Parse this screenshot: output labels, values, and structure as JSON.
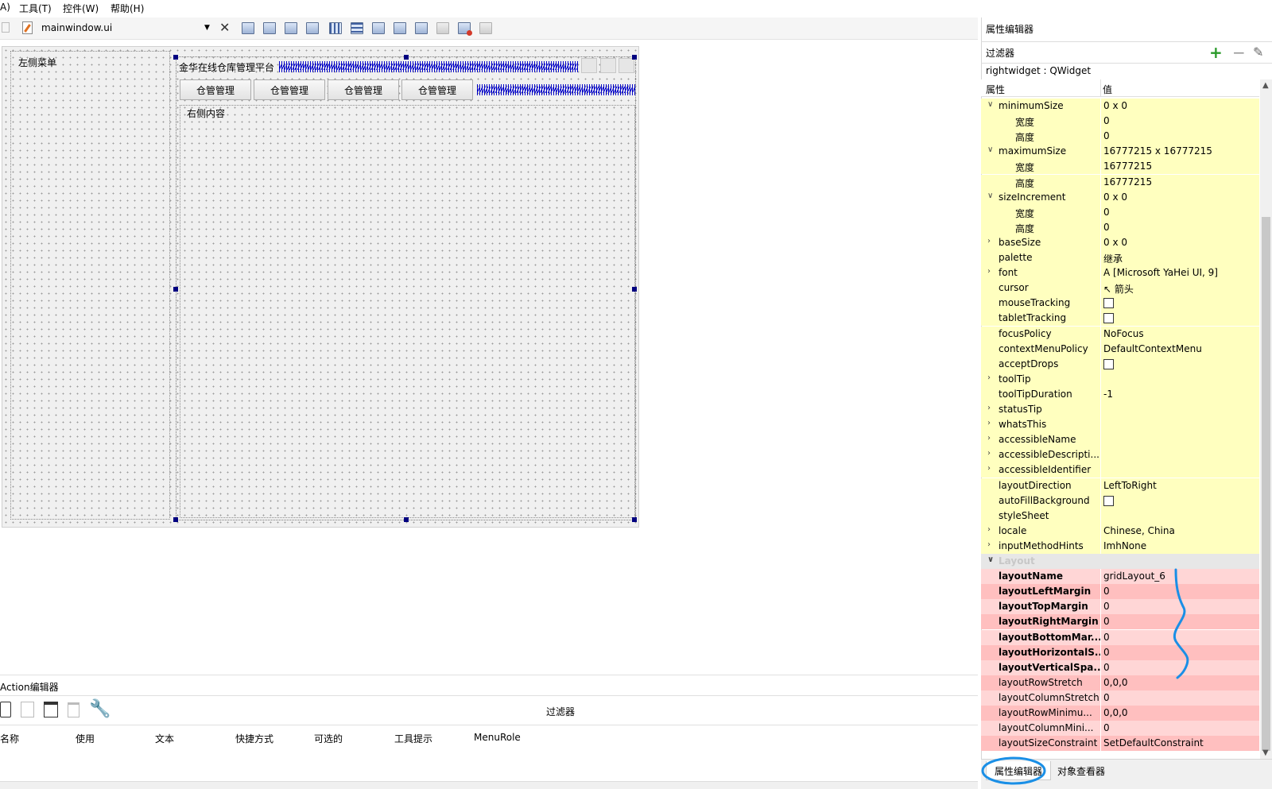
{
  "menubar": {
    "items": [
      "A)",
      "工具(T)",
      "控件(W)",
      "帮助(H)"
    ]
  },
  "toolbar": {
    "file_combo": "mainwindow.ui",
    "icons": [
      "edit-widgets-icon",
      "edit-signals-icon",
      "edit-buddies-icon",
      "edit-tab-order-icon",
      "layout-horizontal-icon",
      "layout-vertical-icon",
      "splitter-horizontal-icon",
      "splitter-vertical-icon",
      "layout-form-icon",
      "layout-grid-icon",
      "break-layout-icon",
      "adjust-size-icon"
    ]
  },
  "form": {
    "left_menu_label": "左侧菜单",
    "title_label": "金华在线仓库管理平台",
    "buttons": [
      "仓管管理",
      "仓管管理",
      "仓管管理",
      "仓管管理"
    ],
    "right_content_label": "右侧内容"
  },
  "action_editor": {
    "title": "Action编辑器",
    "filter_label": "过滤器",
    "columns": [
      "名称",
      "使用",
      "文本",
      "快捷方式",
      "可选的",
      "工具提示",
      "MenuRole"
    ]
  },
  "property_editor": {
    "title": "属性编辑器",
    "filter_label": "过滤器",
    "object_label": "rightwidget : QWidget",
    "header_property": "属性",
    "header_value": "值",
    "rows": [
      {
        "name": "minimumSize",
        "value": "0 x 0",
        "exp": "v"
      },
      {
        "name": "宽度",
        "value": "0",
        "sub": true
      },
      {
        "name": "高度",
        "value": "0",
        "sub": true
      },
      {
        "name": "maximumSize",
        "value": "16777215 x 16777215",
        "exp": "v"
      },
      {
        "name": "宽度",
        "value": "16777215",
        "sub": true
      },
      {
        "name": "高度",
        "value": "16777215",
        "sub": true
      },
      {
        "name": "sizeIncrement",
        "value": "0 x 0",
        "exp": "v"
      },
      {
        "name": "宽度",
        "value": "0",
        "sub": true
      },
      {
        "name": "高度",
        "value": "0",
        "sub": true
      },
      {
        "name": "baseSize",
        "value": "0 x 0",
        "exp": ">"
      },
      {
        "name": "palette",
        "value": "继承"
      },
      {
        "name": "font",
        "value": "A  [Microsoft YaHei UI, 9]",
        "exp": ">"
      },
      {
        "name": "cursor",
        "value": "↖  箭头"
      },
      {
        "name": "mouseTracking",
        "value": "",
        "check": true
      },
      {
        "name": "tabletTracking",
        "value": "",
        "check": true
      },
      {
        "name": "focusPolicy",
        "value": "NoFocus"
      },
      {
        "name": "contextMenuPolicy",
        "value": "DefaultContextMenu"
      },
      {
        "name": "acceptDrops",
        "value": "",
        "check": true
      },
      {
        "name": "toolTip",
        "value": "",
        "exp": ">"
      },
      {
        "name": "toolTipDuration",
        "value": "-1"
      },
      {
        "name": "statusTip",
        "value": "",
        "exp": ">"
      },
      {
        "name": "whatsThis",
        "value": "",
        "exp": ">"
      },
      {
        "name": "accessibleName",
        "value": "",
        "exp": ">"
      },
      {
        "name": "accessibleDescripti...",
        "value": "",
        "exp": ">"
      },
      {
        "name": "accessibleIdentifier",
        "value": "",
        "exp": ">"
      },
      {
        "name": "layoutDirection",
        "value": "LeftToRight"
      },
      {
        "name": "autoFillBackground",
        "value": "",
        "check": true
      },
      {
        "name": "styleSheet",
        "value": ""
      },
      {
        "name": "locale",
        "value": "Chinese, China",
        "exp": ">"
      },
      {
        "name": "inputMethodHints",
        "value": "ImhNone",
        "exp": ">"
      }
    ],
    "layout_group": "Layout",
    "layout_rows": [
      {
        "name": "layoutName",
        "value": "gridLayout_6",
        "bold": true
      },
      {
        "name": "layoutLeftMargin",
        "value": "0",
        "bold": true
      },
      {
        "name": "layoutTopMargin",
        "value": "0",
        "bold": true
      },
      {
        "name": "layoutRightMargin",
        "value": "0",
        "bold": true
      },
      {
        "name": "layoutBottomMar...",
        "value": "0",
        "bold": true
      },
      {
        "name": "layoutHorizontalS...",
        "value": "0",
        "bold": true
      },
      {
        "name": "layoutVerticalSpa...",
        "value": "0",
        "bold": true
      },
      {
        "name": "layoutRowStretch",
        "value": "0,0,0"
      },
      {
        "name": "layoutColumnStretch",
        "value": "0"
      },
      {
        "name": "layoutRowMinimu...",
        "value": "0,0,0"
      },
      {
        "name": "layoutColumnMini...",
        "value": "0"
      },
      {
        "name": "layoutSizeConstraint",
        "value": "SetDefaultConstraint"
      }
    ],
    "tabs": [
      "属性编辑器",
      "对象查看器"
    ]
  },
  "colors": {
    "annotation": "#1a8fe6",
    "row_yellow": "#ffffbf",
    "row_pink": "#ffd6d6",
    "handle": "#000080"
  }
}
